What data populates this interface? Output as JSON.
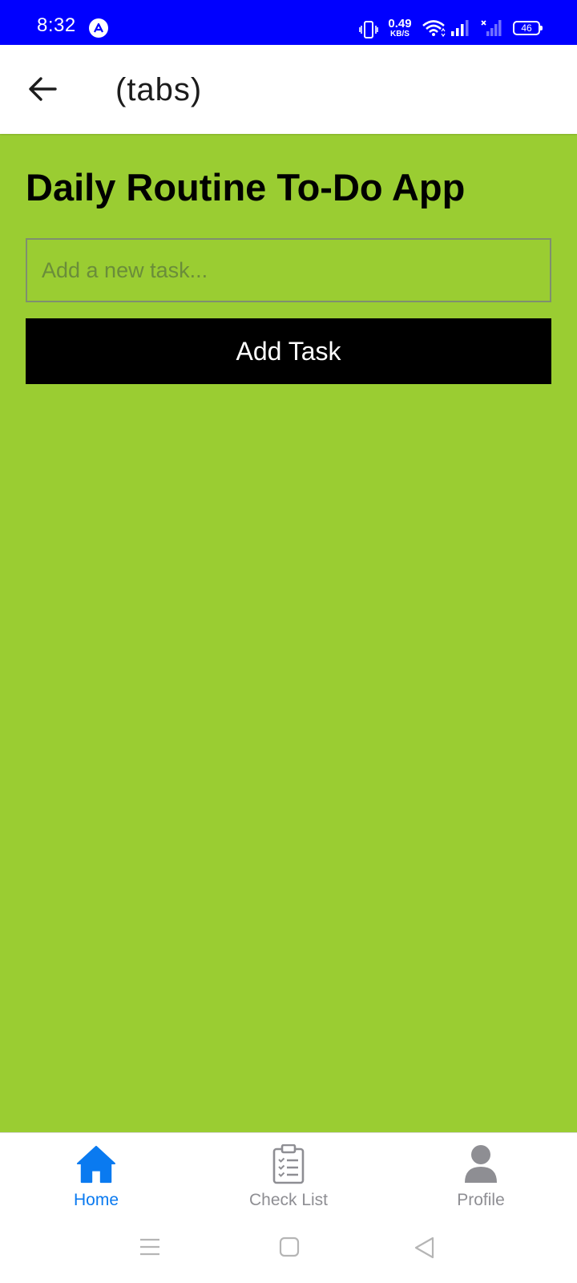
{
  "status_bar": {
    "time": "8:32",
    "net_speed_value": "0.49",
    "net_speed_unit": "KB/S",
    "battery": "46"
  },
  "header": {
    "title": "(tabs)"
  },
  "main": {
    "title": "Daily Routine To-Do App",
    "task_input": {
      "value": "",
      "placeholder": "Add a new task..."
    },
    "add_button_label": "Add Task"
  },
  "tabs": [
    {
      "label": "Home",
      "icon": "home-icon",
      "active": true
    },
    {
      "label": "Check List",
      "icon": "clipboard-list-icon",
      "active": false
    },
    {
      "label": "Profile",
      "icon": "person-icon",
      "active": false
    }
  ],
  "colors": {
    "status_bar": "#0000FF",
    "background": "#9ACD32",
    "button": "#000000",
    "active_tab": "#0A7AF0",
    "inactive_tab": "#8E8E93"
  }
}
